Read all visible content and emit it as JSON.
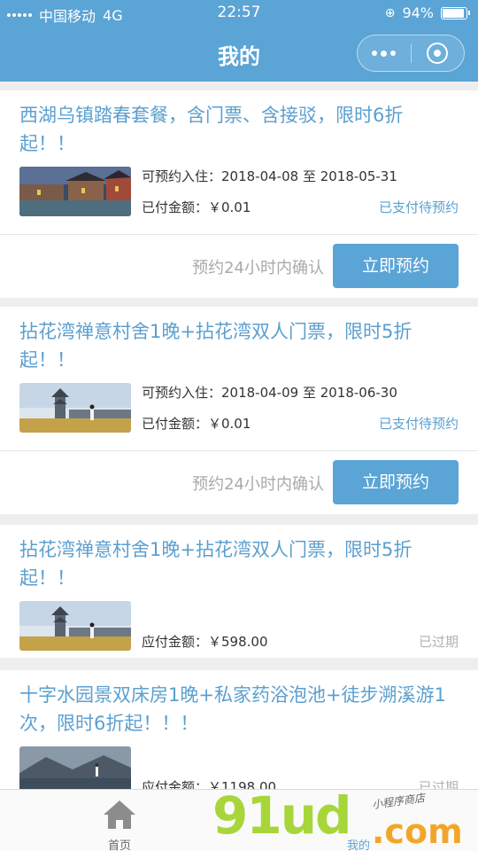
{
  "status_bar": {
    "carrier": "中国移动",
    "network": "4G",
    "time": "22:57",
    "battery": "94%",
    "battery_level": 0.94
  },
  "header": {
    "title": "我的"
  },
  "orders": [
    {
      "title": "西湖乌镇踏春套餐，含门票、含接驳，限时6折起！！",
      "line1": "可预约入住：2018-04-08 至 2018-05-31",
      "line2": "已付金额：￥0.01",
      "status": "已支付待预约",
      "confirm_text": "预约24小时内确认",
      "button_label": "立即预约"
    },
    {
      "title": "拈花湾禅意村舍1晚+拈花湾双人门票，限时5折起！！",
      "line1": "可预约入住：2018-04-09 至 2018-06-30",
      "line2": "已付金额：￥0.01",
      "status": "已支付待预约",
      "confirm_text": "预约24小时内确认",
      "button_label": "立即预约"
    },
    {
      "title": "拈花湾禅意村舍1晚+拈花湾双人门票，限时5折起！！",
      "line1": "应付金额：￥598.00",
      "status": "已过期"
    },
    {
      "title": "十字水园景双床房1晚+私家药浴泡池+徒步溯溪游1次，限时6折起！！！",
      "line1": "应付金额：￥1198.00",
      "status": "已过期"
    }
  ],
  "tabbar": {
    "home_label": "首页",
    "mine_label": "我的"
  },
  "watermark": {
    "brand": "91ud",
    "suffix": ".com",
    "slogan": "小程序商店"
  },
  "colors": {
    "accent": "#5ba4d6",
    "title_text": "#5b9fcf",
    "expired": "#b3b3b3"
  }
}
